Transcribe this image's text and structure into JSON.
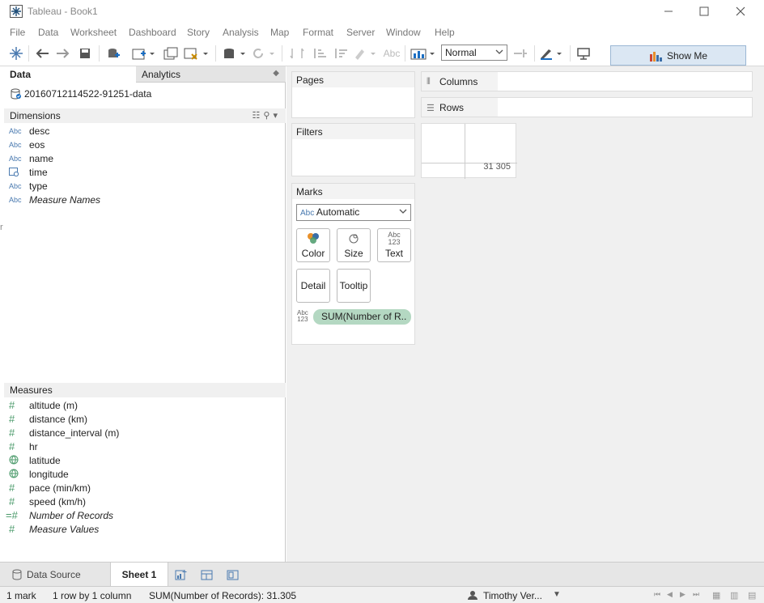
{
  "window": {
    "title": "Tableau - Book1"
  },
  "menu": [
    "File",
    "Data",
    "Worksheet",
    "Dashboard",
    "Story",
    "Analysis",
    "Map",
    "Format",
    "Server",
    "Window",
    "Help"
  ],
  "toolbar": {
    "fit_value": "Normal",
    "show_me_label": "Show Me"
  },
  "data_pane": {
    "tab_data": "Data",
    "tab_analytics": "Analytics",
    "datasource_name": "20160712114522-91251-data",
    "dimensions_header": "Dimensions",
    "dimensions": [
      {
        "type": "Abc",
        "name": "desc"
      },
      {
        "type": "Abc",
        "name": "eos"
      },
      {
        "type": "Abc",
        "name": "name"
      },
      {
        "type": "date",
        "name": "time"
      },
      {
        "type": "Abc",
        "name": "type"
      },
      {
        "type": "Abc",
        "name": "Measure Names"
      }
    ],
    "measures_header": "Measures",
    "measures": [
      {
        "type": "#",
        "name": "altitude (m)"
      },
      {
        "type": "#",
        "name": "distance (km)"
      },
      {
        "type": "#",
        "name": "distance_interval (m)"
      },
      {
        "type": "#",
        "name": "hr"
      },
      {
        "type": "geo",
        "name": "latitude"
      },
      {
        "type": "geo",
        "name": "longitude"
      },
      {
        "type": "#",
        "name": "pace (min/km)"
      },
      {
        "type": "#",
        "name": "speed (km/h)"
      },
      {
        "type": "=#",
        "name": "Number of Records"
      },
      {
        "type": "#",
        "name": "Measure Values"
      }
    ]
  },
  "cards": {
    "pages": "Pages",
    "filters": "Filters",
    "marks": "Marks",
    "mark_type_abc": "Abc",
    "mark_type": "Automatic",
    "color": "Color",
    "size": "Size",
    "text": "Text",
    "text_icon_top": "Abc",
    "text_icon_bottom": "123",
    "detail": "Detail",
    "tooltip": "Tooltip",
    "pill": "SUM(Number of R..",
    "pill_icon_top": "Abc",
    "pill_icon_bottom": "123"
  },
  "shelves": {
    "columns": "Columns",
    "rows": "Rows"
  },
  "view": {
    "value": "31 305"
  },
  "sheet_tabs": {
    "data_source": "Data Source",
    "sheet": "Sheet 1"
  },
  "status": {
    "marks": "1 mark",
    "dims": "1 row by 1 column",
    "sum": "SUM(Number of Records): 31.305",
    "user": "Timothy Ver..."
  }
}
